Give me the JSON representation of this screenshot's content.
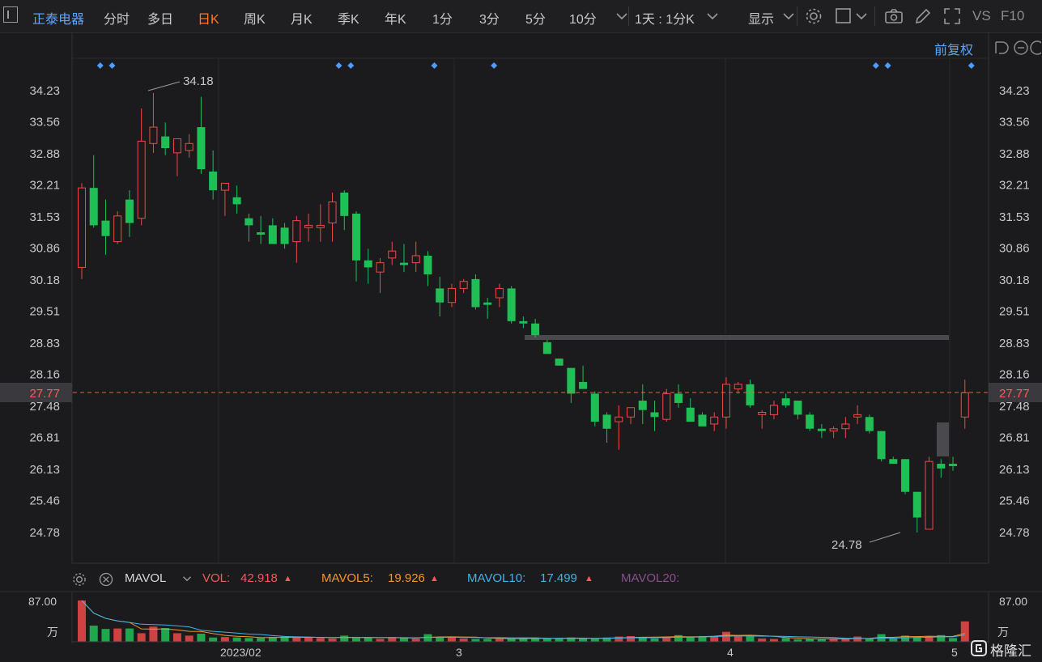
{
  "toolbar": {
    "stock_name": "正泰电器",
    "periods": [
      "分时",
      "多日",
      "日K",
      "周K",
      "月K",
      "季K",
      "年K",
      "1分",
      "3分",
      "5分",
      "10分"
    ],
    "active_period": "日K",
    "combo": "1天 : 1分K",
    "display": "显示",
    "vs": "VS",
    "f10": "F10"
  },
  "price_panel": {
    "adjust_label": "前复权",
    "last_price": "27.77",
    "high_label": "34.18",
    "low_label": "24.78",
    "y_ticks": [
      "34.23",
      "33.56",
      "32.88",
      "32.21",
      "31.53",
      "30.86",
      "30.18",
      "29.51",
      "28.83",
      "28.16",
      "27.48",
      "26.81",
      "26.13",
      "25.46",
      "24.78"
    ]
  },
  "volume_panel": {
    "indicator": "MAVOL",
    "vol_label": "VOL:",
    "vol_value": "42.918",
    "mavol5_label": "MAVOL5:",
    "mavol5_value": "19.926",
    "mavol10_label": "MAVOL10:",
    "mavol10_value": "17.499",
    "mavol20_label": "MAVOL20:",
    "y_top": "87.00",
    "unit": "万"
  },
  "x_labels": [
    "2023/02",
    "3",
    "4",
    "5"
  ],
  "watermark": "格隆汇",
  "colors": {
    "up": "#f04848",
    "down": "#1fbf56",
    "bg": "#1b1b1d",
    "accent": "#ff7a2a",
    "link": "#5aa6ff"
  },
  "chart_data": {
    "type": "candlestick",
    "title": "",
    "ylim": [
      24.5,
      34.6
    ],
    "y_ticks": [
      34.23,
      33.56,
      32.88,
      32.21,
      31.53,
      30.86,
      30.18,
      29.51,
      28.83,
      28.16,
      27.48,
      26.81,
      26.13,
      25.46,
      24.78
    ],
    "last_price": 27.77,
    "resistance_level": 28.95,
    "candles": [
      {
        "o": 30.45,
        "h": 32.25,
        "l": 30.2,
        "c": 32.15
      },
      {
        "o": 32.15,
        "h": 32.85,
        "l": 31.3,
        "c": 31.35
      },
      {
        "o": 31.45,
        "h": 31.9,
        "l": 30.72,
        "c": 31.12
      },
      {
        "o": 31.0,
        "h": 31.65,
        "l": 30.95,
        "c": 31.55
      },
      {
        "o": 31.9,
        "h": 32.1,
        "l": 31.1,
        "c": 31.4
      },
      {
        "o": 31.5,
        "h": 33.85,
        "l": 31.35,
        "c": 33.15
      },
      {
        "o": 33.1,
        "h": 34.18,
        "l": 32.9,
        "c": 33.45
      },
      {
        "o": 33.25,
        "h": 33.55,
        "l": 32.85,
        "c": 33.0
      },
      {
        "o": 32.9,
        "h": 33.2,
        "l": 32.4,
        "c": 33.2
      },
      {
        "o": 32.95,
        "h": 33.3,
        "l": 32.8,
        "c": 33.1
      },
      {
        "o": 33.45,
        "h": 34.1,
        "l": 32.45,
        "c": 32.55
      },
      {
        "o": 32.5,
        "h": 32.95,
        "l": 31.9,
        "c": 32.1
      },
      {
        "o": 32.1,
        "h": 32.25,
        "l": 31.55,
        "c": 32.25
      },
      {
        "o": 31.95,
        "h": 32.2,
        "l": 31.6,
        "c": 31.8
      },
      {
        "o": 31.5,
        "h": 31.6,
        "l": 31.0,
        "c": 31.35
      },
      {
        "o": 31.2,
        "h": 31.55,
        "l": 30.95,
        "c": 31.15
      },
      {
        "o": 31.35,
        "h": 31.5,
        "l": 30.95,
        "c": 30.95
      },
      {
        "o": 31.3,
        "h": 31.4,
        "l": 30.85,
        "c": 30.95
      },
      {
        "o": 31.0,
        "h": 31.55,
        "l": 30.55,
        "c": 31.45
      },
      {
        "o": 31.3,
        "h": 31.6,
        "l": 31.0,
        "c": 31.35
      },
      {
        "o": 31.3,
        "h": 31.8,
        "l": 31.0,
        "c": 31.35
      },
      {
        "o": 31.4,
        "h": 32.05,
        "l": 31.0,
        "c": 31.85
      },
      {
        "o": 32.05,
        "h": 32.1,
        "l": 31.25,
        "c": 31.55
      },
      {
        "o": 31.6,
        "h": 31.65,
        "l": 30.15,
        "c": 30.6
      },
      {
        "o": 30.6,
        "h": 30.85,
        "l": 30.1,
        "c": 30.45
      },
      {
        "o": 30.35,
        "h": 30.65,
        "l": 29.9,
        "c": 30.55
      },
      {
        "o": 30.65,
        "h": 31.0,
        "l": 30.5,
        "c": 30.8
      },
      {
        "o": 30.55,
        "h": 30.95,
        "l": 30.35,
        "c": 30.5
      },
      {
        "o": 30.55,
        "h": 31.0,
        "l": 30.35,
        "c": 30.7
      },
      {
        "o": 30.7,
        "h": 30.8,
        "l": 30.05,
        "c": 30.3
      },
      {
        "o": 30.0,
        "h": 30.25,
        "l": 29.4,
        "c": 29.7
      },
      {
        "o": 29.7,
        "h": 30.1,
        "l": 29.6,
        "c": 30.0
      },
      {
        "o": 30.0,
        "h": 30.2,
        "l": 29.9,
        "c": 30.15
      },
      {
        "o": 30.2,
        "h": 30.3,
        "l": 29.55,
        "c": 29.6
      },
      {
        "o": 29.7,
        "h": 29.8,
        "l": 29.35,
        "c": 29.65
      },
      {
        "o": 29.8,
        "h": 30.1,
        "l": 29.6,
        "c": 30.0
      },
      {
        "o": 30.0,
        "h": 30.05,
        "l": 29.25,
        "c": 29.3
      },
      {
        "o": 29.3,
        "h": 29.4,
        "l": 29.15,
        "c": 29.25
      },
      {
        "o": 29.25,
        "h": 29.35,
        "l": 28.95,
        "c": 29.0
      },
      {
        "o": 28.85,
        "h": 28.9,
        "l": 28.6,
        "c": 28.6
      },
      {
        "o": 28.5,
        "h": 28.5,
        "l": 28.35,
        "c": 28.35
      },
      {
        "o": 28.3,
        "h": 28.3,
        "l": 27.55,
        "c": 27.75
      },
      {
        "o": 28.0,
        "h": 28.35,
        "l": 27.85,
        "c": 27.85
      },
      {
        "o": 27.75,
        "h": 27.8,
        "l": 27.05,
        "c": 27.15
      },
      {
        "o": 27.3,
        "h": 27.35,
        "l": 26.7,
        "c": 27.0
      },
      {
        "o": 27.15,
        "h": 27.5,
        "l": 26.55,
        "c": 27.25
      },
      {
        "o": 27.25,
        "h": 27.45,
        "l": 27.1,
        "c": 27.45
      },
      {
        "o": 27.6,
        "h": 27.95,
        "l": 27.1,
        "c": 27.4
      },
      {
        "o": 27.35,
        "h": 27.6,
        "l": 26.95,
        "c": 27.25
      },
      {
        "o": 27.2,
        "h": 27.85,
        "l": 27.15,
        "c": 27.75
      },
      {
        "o": 27.75,
        "h": 27.95,
        "l": 27.45,
        "c": 27.55
      },
      {
        "o": 27.45,
        "h": 27.65,
        "l": 27.15,
        "c": 27.15
      },
      {
        "o": 27.3,
        "h": 27.35,
        "l": 27.05,
        "c": 27.05
      },
      {
        "o": 27.1,
        "h": 27.35,
        "l": 26.95,
        "c": 27.25
      },
      {
        "o": 27.25,
        "h": 28.1,
        "l": 27.0,
        "c": 27.95
      },
      {
        "o": 27.85,
        "h": 28.0,
        "l": 27.75,
        "c": 27.95
      },
      {
        "o": 27.95,
        "h": 28.05,
        "l": 27.45,
        "c": 27.5
      },
      {
        "o": 27.3,
        "h": 27.4,
        "l": 27.0,
        "c": 27.35
      },
      {
        "o": 27.3,
        "h": 27.6,
        "l": 27.2,
        "c": 27.5
      },
      {
        "o": 27.65,
        "h": 27.75,
        "l": 27.45,
        "c": 27.5
      },
      {
        "o": 27.6,
        "h": 27.6,
        "l": 27.2,
        "c": 27.3
      },
      {
        "o": 27.3,
        "h": 27.35,
        "l": 26.95,
        "c": 27.0
      },
      {
        "o": 27.0,
        "h": 27.1,
        "l": 26.8,
        "c": 26.95
      },
      {
        "o": 26.95,
        "h": 27.05,
        "l": 26.8,
        "c": 27.0
      },
      {
        "o": 27.0,
        "h": 27.25,
        "l": 26.8,
        "c": 27.1
      },
      {
        "o": 27.25,
        "h": 27.5,
        "l": 27.1,
        "c": 27.3
      },
      {
        "o": 27.25,
        "h": 27.3,
        "l": 26.9,
        "c": 26.95
      },
      {
        "o": 26.95,
        "h": 26.95,
        "l": 26.3,
        "c": 26.35
      },
      {
        "o": 26.35,
        "h": 26.4,
        "l": 26.25,
        "c": 26.25
      },
      {
        "o": 26.35,
        "h": 26.35,
        "l": 25.6,
        "c": 25.65
      },
      {
        "o": 25.65,
        "h": 25.65,
        "l": 24.78,
        "c": 25.1
      },
      {
        "o": 24.85,
        "h": 26.4,
        "l": 24.85,
        "c": 26.3
      },
      {
        "o": 26.25,
        "h": 26.35,
        "l": 25.95,
        "c": 26.15
      },
      {
        "o": 26.25,
        "h": 26.4,
        "l": 26.1,
        "c": 26.2
      },
      {
        "o": 27.25,
        "h": 28.05,
        "l": 27.0,
        "c": 27.77
      }
    ],
    "volume": [
      87,
      34,
      27,
      28,
      28,
      18,
      32,
      29,
      18,
      13,
      17,
      9,
      10,
      9,
      8,
      8,
      10,
      11,
      9,
      9,
      8,
      7,
      13,
      8,
      9,
      6,
      9,
      9,
      7,
      16,
      10,
      10,
      7,
      6,
      6,
      7,
      6,
      8,
      8,
      7,
      7,
      9,
      7,
      6,
      9,
      11,
      12,
      10,
      7,
      11,
      14,
      10,
      12,
      12,
      21,
      12,
      12,
      7,
      6,
      8,
      5,
      6,
      5,
      7,
      6,
      11,
      7,
      16,
      7,
      13,
      11,
      12,
      14,
      8,
      42.918
    ],
    "vol_ylim": [
      0,
      87
    ],
    "mavol5_current": 19.926,
    "mavol10_current": 17.499,
    "event_markers": [
      1,
      2,
      21,
      22,
      29,
      34,
      66,
      67,
      74
    ]
  }
}
